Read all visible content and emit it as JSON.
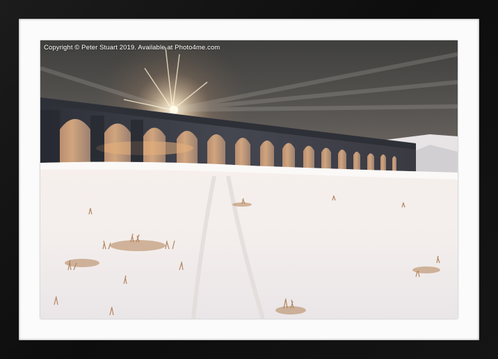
{
  "watermark": {
    "text": "Copyright  © Peter Stuart  2019. Available at Photo4me.com"
  },
  "colors": {
    "frame": "#151515",
    "mount": "#fbfbfb",
    "sky": "#4a4a48",
    "snow": "#f3eeec",
    "grass": "#b07a4a",
    "stone": "#3a3c44",
    "sun": "#fff6dc"
  },
  "scene": {
    "subject": "stone railway viaduct over snow-covered moorland at sunrise",
    "icons": [
      "sun-icon",
      "viaduct-icon"
    ]
  }
}
